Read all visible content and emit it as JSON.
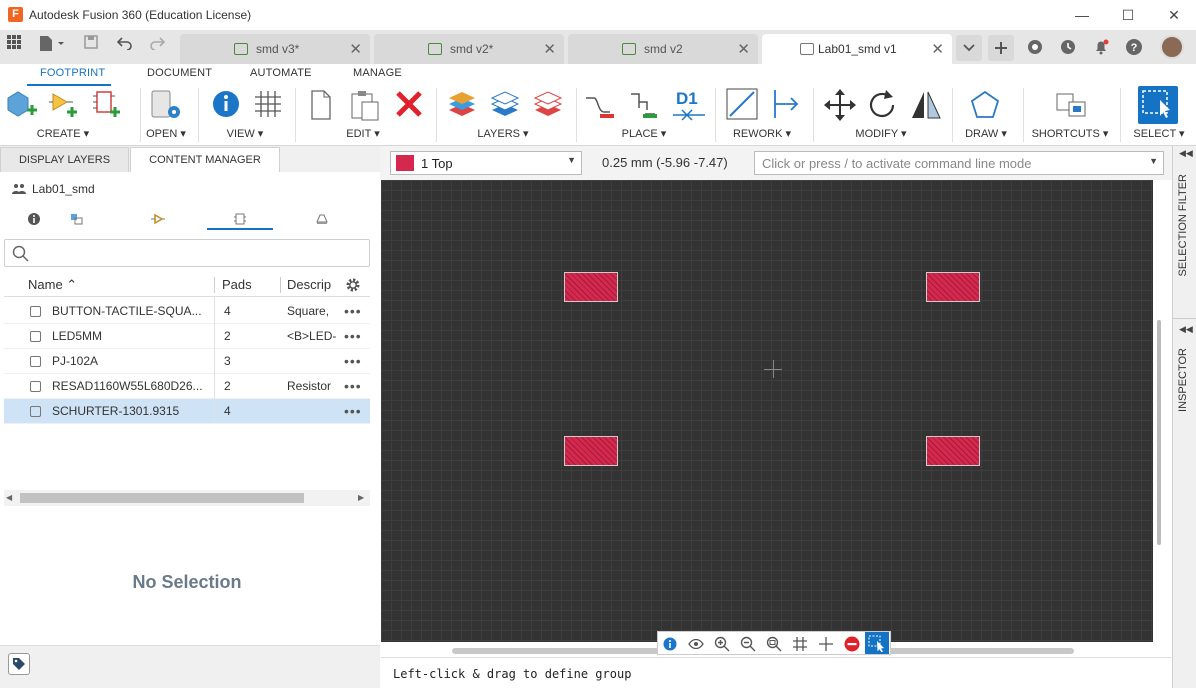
{
  "window": {
    "title": "Autodesk Fusion 360 (Education License)",
    "minimize": "—",
    "maximize": "☐",
    "close": "✕"
  },
  "tabs": [
    {
      "label": "smd v3*",
      "close": "✕"
    },
    {
      "label": "smd v2*",
      "close": "✕"
    },
    {
      "label": "smd v2",
      "close": "✕"
    },
    {
      "label": "Lab01_smd v1",
      "close": "✕"
    }
  ],
  "ribbon": {
    "tabs": [
      "FOOTPRINT",
      "DOCUMENT",
      "AUTOMATE",
      "MANAGE"
    ],
    "groups": {
      "create": "CREATE ▾",
      "open": "OPEN ▾",
      "view": "VIEW ▾",
      "edit": "EDIT ▾",
      "layers": "LAYERS ▾",
      "place": "PLACE ▾",
      "rework": "REWORK ▾",
      "modify": "MODIFY ▾",
      "draw": "DRAW ▾",
      "shortcuts": "SHORTCUTS ▾",
      "select": "SELECT ▾"
    },
    "place_text_icon": "D1"
  },
  "panel": {
    "tabs": [
      "DISPLAY LAYERS",
      "CONTENT MANAGER"
    ],
    "project": "Lab01_smd",
    "search_placeholder": "",
    "columns": {
      "name": "Name ⌃",
      "pads": "Pads",
      "description": "Descrip"
    },
    "rows": [
      {
        "name": "BUTTON-TACTILE-SQUA...",
        "pads": "4",
        "desc": "Square,",
        "more": "•••"
      },
      {
        "name": "LED5MM",
        "pads": "2",
        "desc": "<B>LED-",
        "more": "•••"
      },
      {
        "name": "PJ-102A",
        "pads": "3",
        "desc": "",
        "more": "•••"
      },
      {
        "name": "RESAD1160W55L680D26...",
        "pads": "2",
        "desc": "Resistor",
        "more": "•••"
      },
      {
        "name": "SCHURTER-1301.9315",
        "pads": "4",
        "desc": "",
        "more": "•••"
      }
    ],
    "selected_row": 4,
    "no_selection": "No Selection"
  },
  "commandbar": {
    "layer": "1 Top",
    "coordinates": "0.25 mm (-5.96 -7.47)",
    "command_placeholder": "Click or press / to activate command line mode"
  },
  "side": {
    "selection_filter": "SELECTION FILTER",
    "inspector": "INSPECTOR"
  },
  "status": "Left-click & drag to define group",
  "colors": {
    "accent": "#1473c4",
    "pad": "#d6284f",
    "canvas": "#333333"
  }
}
